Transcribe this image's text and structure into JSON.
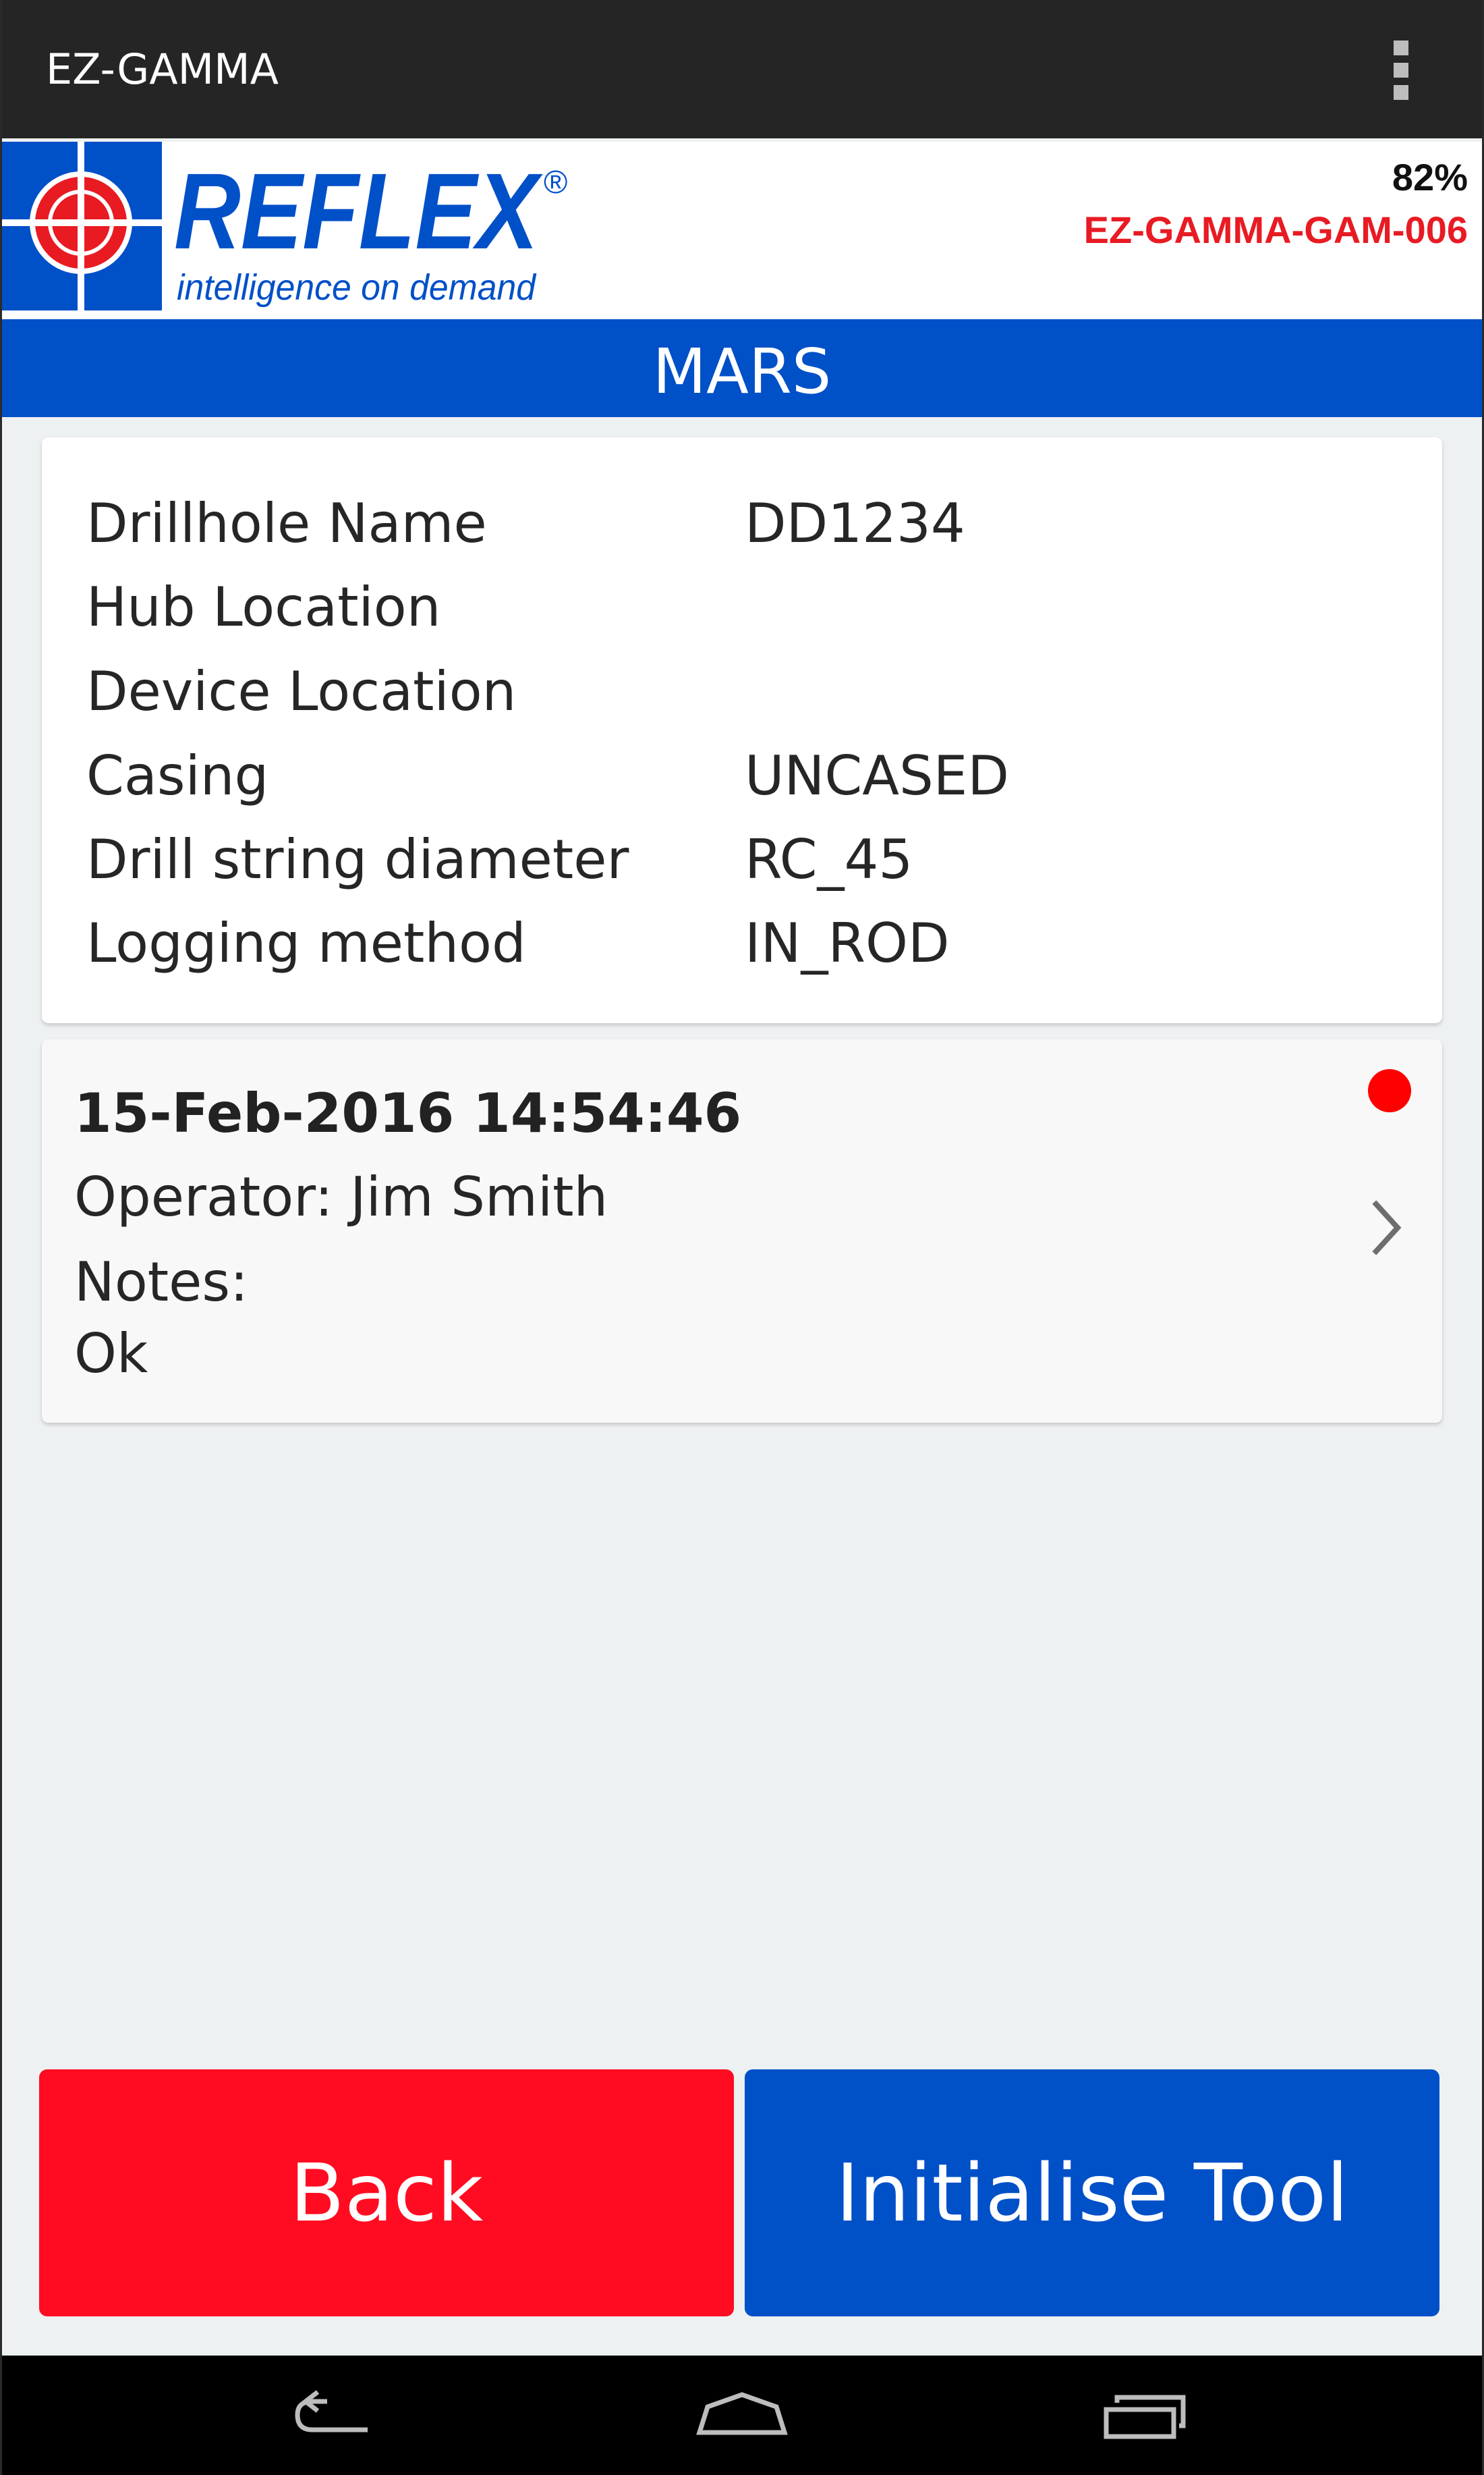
{
  "app": {
    "title": "EZ-GAMMA"
  },
  "header": {
    "logo_brand": "REFLEX",
    "logo_registered": "®",
    "logo_tagline": "intelligence on demand",
    "battery": "82%",
    "device_id": "EZ-GAMMA-GAM-006",
    "device_id_color": "#e81b23"
  },
  "site": {
    "name": "MARS",
    "bar_color": "#0050c8"
  },
  "drillhole": {
    "rows": [
      {
        "label": "Drillhole Name",
        "value": "DD1234"
      },
      {
        "label": "Hub Location",
        "value": ""
      },
      {
        "label": "Device Location",
        "value": ""
      },
      {
        "label": "Casing",
        "value": "UNCASED"
      },
      {
        "label": "Drill string diameter",
        "value": "RC_45"
      },
      {
        "label": "Logging method",
        "value": "IN_ROD"
      }
    ]
  },
  "record": {
    "datetime": "15-Feb-2016 14:54:46",
    "operator": "Operator: Jim Smith",
    "notes_label": "Notes:",
    "notes": "Ok",
    "status_color": "#ff0000",
    "status_icon": "status-dot-icon"
  },
  "buttons": {
    "back_label": "Back",
    "back_color": "#ff0c22",
    "initialise_label": "Initialise Tool",
    "initialise_color": "#0050c8"
  },
  "nav": {
    "icons": [
      "back-icon",
      "home-icon",
      "recents-icon"
    ]
  }
}
